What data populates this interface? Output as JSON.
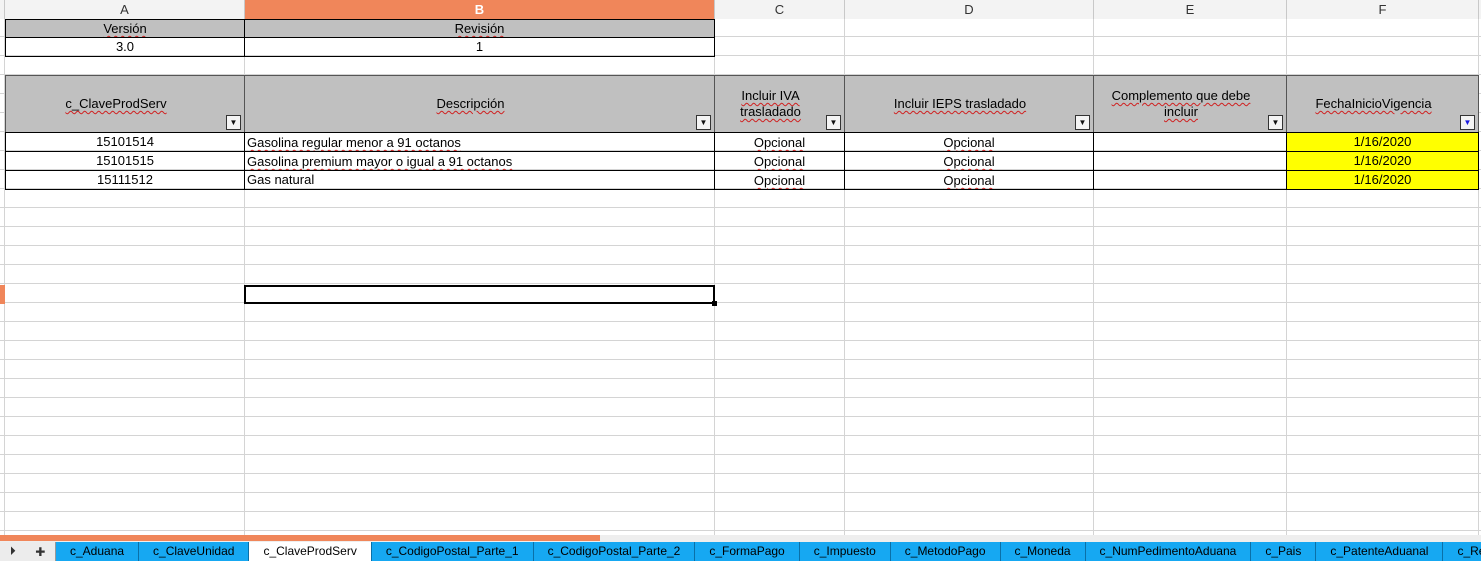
{
  "columns": [
    "A",
    "B",
    "C",
    "D",
    "E",
    "F"
  ],
  "version_block": {
    "version_label": "Versión",
    "revision_label": "Revisión",
    "version_value": "3.0",
    "revision_value": "1"
  },
  "table": {
    "headers": [
      "c_ClaveProdServ",
      "Descripción",
      "Incluir IVA trasladado",
      "Incluir IEPS trasladado",
      "Complemento que debe incluir",
      "FechaInicioVigencia"
    ],
    "rows": [
      {
        "clave": "15101514",
        "descripcion": "Gasolina regular menor a 91 octanos",
        "iva": "Opcional",
        "ieps": "Opcional",
        "complemento": "",
        "fecha": "1/16/2020"
      },
      {
        "clave": "15101515",
        "descripcion": "Gasolina premium mayor o igual a 91 octanos",
        "iva": "Opcional",
        "ieps": "Opcional",
        "complemento": "",
        "fecha": "1/16/2020"
      },
      {
        "clave": "15111512",
        "descripcion": "Gas natural",
        "iva": "Opcional",
        "ieps": "Opcional",
        "complemento": "",
        "fecha": "1/16/2020"
      }
    ]
  },
  "colors": {
    "active_accent": "#f0865a",
    "highlight": "#ffff00",
    "tab_bar": "#16a8f2"
  },
  "tab_nav": {
    "last_icon": "last-sheet-icon",
    "add_icon": "add-sheet-icon",
    "last_glyph": "⏵",
    "add_glyph": "✚"
  },
  "sheet_tabs": [
    "c_Aduana",
    "c_ClaveUnidad",
    "c_ClaveProdServ",
    "c_CodigoPostal_Parte_1",
    "c_CodigoPostal_Parte_2",
    "c_FormaPago",
    "c_Impuesto",
    "c_MetodoPago",
    "c_Moneda",
    "c_NumPedimentoAduana",
    "c_Pais",
    "c_PatenteAduanal",
    "c_Regim"
  ],
  "active_tab": "c_ClaveProdServ"
}
